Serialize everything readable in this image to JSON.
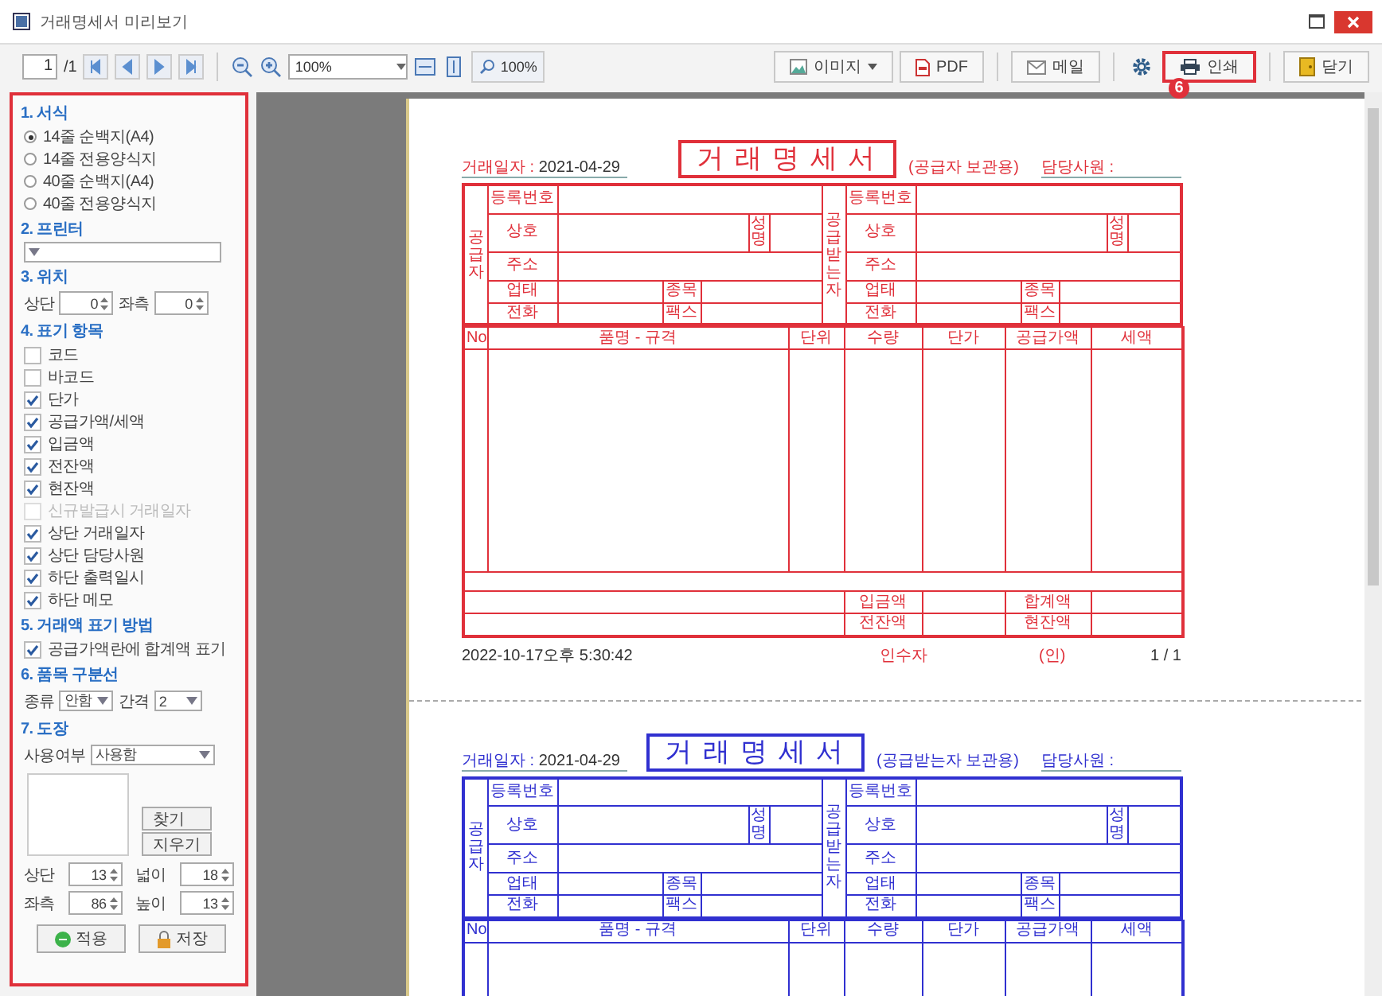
{
  "window": {
    "title": "거래명세서 미리보기"
  },
  "toolbar": {
    "page": "1",
    "page_total": "/1",
    "zoom": "100%",
    "actual_size": "100%",
    "buttons": [
      {
        "kind": "image",
        "label": "이미지",
        "highlighted": false
      },
      {
        "kind": "pdf",
        "label": "PDF",
        "highlighted": false
      },
      {
        "kind": "mail",
        "label": "메일",
        "highlighted": false
      },
      {
        "kind": "settings",
        "highlighted": false
      },
      {
        "kind": "print",
        "label": "인쇄",
        "highlighted": true,
        "badge": "6"
      },
      {
        "kind": "close",
        "label": "닫기",
        "highlighted": false
      }
    ]
  },
  "options": {
    "highlighted": true,
    "sections": [
      {
        "kind": "radios",
        "title": "1. 서식",
        "items": [
          {
            "label": "14줄 순백지(A4)",
            "selected": true
          },
          {
            "label": "14줄 전용양식지",
            "selected": false
          },
          {
            "label": "40줄 순백지(A4)",
            "selected": false
          },
          {
            "label": "40줄 전용양식지",
            "selected": false
          }
        ]
      },
      {
        "kind": "select",
        "title": "2. 프린터"
      },
      {
        "kind": "spins",
        "title": "3. 위치",
        "fields": [
          {
            "label": "상단",
            "value": "0"
          },
          {
            "label": "좌측",
            "value": "0"
          }
        ]
      },
      {
        "kind": "checks",
        "title": "4. 표기 항목",
        "items": [
          {
            "label": "코드",
            "checked": false,
            "disabled": false
          },
          {
            "label": "바코드",
            "checked": false,
            "disabled": false
          },
          {
            "label": "단가",
            "checked": true,
            "disabled": false
          },
          {
            "label": "공급가액/세액",
            "checked": true,
            "disabled": false
          },
          {
            "label": "입금액",
            "checked": true,
            "disabled": false
          },
          {
            "label": "전잔액",
            "checked": true,
            "disabled": false
          },
          {
            "label": "현잔액",
            "checked": true,
            "disabled": false
          },
          {
            "label": "신규발급시 거래일자",
            "checked": false,
            "disabled": true
          },
          {
            "label": "상단 거래일자",
            "checked": true,
            "disabled": false
          },
          {
            "label": "상단 담당사원",
            "checked": true,
            "disabled": false
          },
          {
            "label": "하단 출력일시",
            "checked": true,
            "disabled": false
          },
          {
            "label": "하단 메모",
            "checked": true,
            "disabled": false
          }
        ]
      },
      {
        "kind": "checks",
        "title": "5. 거래액 표기 방법",
        "items": [
          {
            "label": "공급가액란에 합계액 표기",
            "checked": true,
            "disabled": false
          }
        ]
      },
      {
        "kind": "combos",
        "title": "6. 품목 구분선",
        "fields": [
          {
            "label": "종류",
            "value": "안함"
          },
          {
            "label": "간격",
            "value": "2"
          }
        ]
      },
      {
        "kind": "stamp",
        "title": "7. 도장",
        "use_label": "사용여부",
        "use_value": "사용함",
        "buttons": [
          "찾기",
          "지우기"
        ],
        "fields": [
          {
            "label": "상단",
            "value": "13"
          },
          {
            "label": "넓이",
            "value": "18"
          },
          {
            "label": "좌측",
            "value": "86"
          },
          {
            "label": "높이",
            "value": "13"
          }
        ]
      }
    ],
    "actions": [
      {
        "kind": "apply",
        "label": "적용"
      },
      {
        "kind": "save",
        "label": "저장"
      }
    ]
  },
  "invoices": [
    {
      "color": "#e0303a",
      "date_label": "거래일자 :",
      "date": "2021-04-29",
      "title": "거 래 명 세 서",
      "copy": "(공급자 보관용)",
      "staff": "담당사원 :",
      "parties": [
        {
          "side": "공급자",
          "reg": "등록번호",
          "name": "상호",
          "rep": "성명",
          "addr": "주소",
          "biz": "업태",
          "item": "종목",
          "tel": "전화",
          "fax": "팩스"
        },
        {
          "side": "공급받는자",
          "reg": "등록번호",
          "name": "상호",
          "rep": "성명",
          "addr": "주소",
          "biz": "업태",
          "item": "종목",
          "tel": "전화",
          "fax": "팩스"
        }
      ],
      "columns": [
        "No",
        "품명 - 규격",
        "단위",
        "수량",
        "단가",
        "공급가액",
        "세액"
      ],
      "totals": [
        "입금액",
        "합계액",
        "전잔액",
        "현잔액"
      ],
      "footer": {
        "printed": "2022-10-17오후 5:30:42",
        "receiver": "인수자",
        "seal": "(인)",
        "page": "1 / 1"
      }
    },
    {
      "color": "#3030d0",
      "date_label": "거래일자 :",
      "date": "2021-04-29",
      "title": "거 래 명 세 서",
      "copy": "(공급받는자 보관용)",
      "staff": "담당사원 :",
      "parties": [
        {
          "side": "공급자",
          "reg": "등록번호",
          "name": "상호",
          "rep": "성명",
          "addr": "주소",
          "biz": "업태",
          "item": "종목",
          "tel": "전화",
          "fax": "팩스"
        },
        {
          "side": "공급받는자",
          "reg": "등록번호",
          "name": "상호",
          "rep": "성명",
          "addr": "주소",
          "biz": "업태",
          "item": "종목",
          "tel": "전화",
          "fax": "팩스"
        }
      ],
      "columns": [
        "No",
        "품명 - 규격",
        "단위",
        "수량",
        "단가",
        "공급가액",
        "세액"
      ]
    }
  ]
}
